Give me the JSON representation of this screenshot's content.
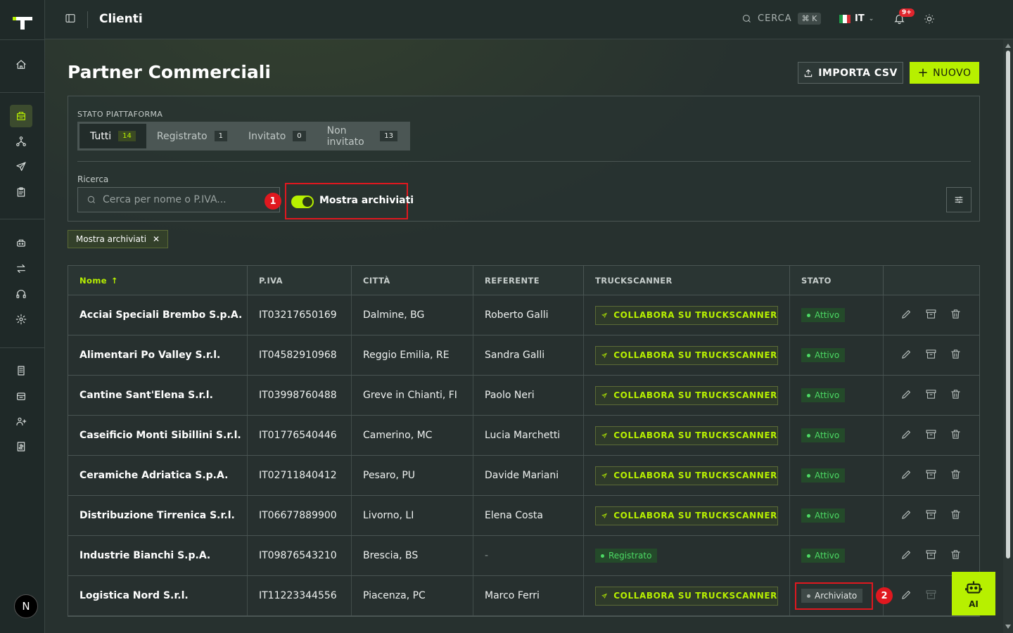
{
  "topbar": {
    "title": "Clienti",
    "search_label": "CERCA",
    "search_shortcut": "⌘ K",
    "language": "IT",
    "notifications_badge": "9+"
  },
  "header": {
    "title": "Partner Commerciali",
    "import_label": "IMPORTA CSV",
    "new_label": "NUOVO"
  },
  "filters": {
    "status_label": "STATO PIATTAFORMA",
    "segments": [
      {
        "label": "Tutti",
        "count": "14"
      },
      {
        "label": "Registrato",
        "count": "1"
      },
      {
        "label": "Invitato",
        "count": "0"
      },
      {
        "label": "Non invitato",
        "count": "13"
      }
    ],
    "search_label": "Ricerca",
    "search_placeholder": "Cerca per nome o P.IVA...",
    "toggle_label": "Mostra archiviati",
    "active_chip": "Mostra archiviati"
  },
  "markers": [
    "1",
    "2"
  ],
  "table": {
    "columns": [
      "Nome",
      "P.IVA",
      "CITTÀ",
      "REFERENTE",
      "TRUCKSCANNER",
      "STATO",
      ""
    ],
    "collab_label": "COLLABORA SU TRUCKSCANNER",
    "rows": [
      {
        "name": "Acciai Speciali Brembo S.p.A.",
        "piva": "IT03217650169",
        "city": "Dalmine, BG",
        "ref": "Roberto Galli",
        "ts": "collab",
        "ts_text": "",
        "status": "Attivo"
      },
      {
        "name": "Alimentari Po Valley S.r.l.",
        "piva": "IT04582910968",
        "city": "Reggio Emilia, RE",
        "ref": "Sandra Galli",
        "ts": "collab",
        "ts_text": "",
        "status": "Attivo"
      },
      {
        "name": "Cantine Sant'Elena S.r.l.",
        "piva": "IT03998760488",
        "city": "Greve in Chianti, FI",
        "ref": "Paolo Neri",
        "ts": "collab",
        "ts_text": "",
        "status": "Attivo"
      },
      {
        "name": "Caseificio Monti Sibillini S.r.l.",
        "piva": "IT01776540446",
        "city": "Camerino, MC",
        "ref": "Lucia Marchetti",
        "ts": "collab",
        "ts_text": "",
        "status": "Attivo"
      },
      {
        "name": "Ceramiche Adriatica S.p.A.",
        "piva": "IT02711840412",
        "city": "Pesaro, PU",
        "ref": "Davide Mariani",
        "ts": "collab",
        "ts_text": "",
        "status": "Attivo"
      },
      {
        "name": "Distribuzione Tirrenica S.r.l.",
        "piva": "IT06677889900",
        "city": "Livorno, LI",
        "ref": "Elena Costa",
        "ts": "collab",
        "ts_text": "",
        "status": "Attivo"
      },
      {
        "name": "Industrie Bianchi S.p.A.",
        "piva": "IT09876543210",
        "city": "Brescia, BS",
        "ref": "-",
        "ts": "registered",
        "ts_text": "Registrato",
        "status": "Attivo"
      },
      {
        "name": "Logistica Nord S.r.l.",
        "piva": "IT11223344556",
        "city": "Piacenza, PC",
        "ref": "Marco Ferri",
        "ts": "collab",
        "ts_text": "",
        "status": "Archiviato"
      }
    ]
  },
  "ai_button": {
    "label": "AI"
  }
}
